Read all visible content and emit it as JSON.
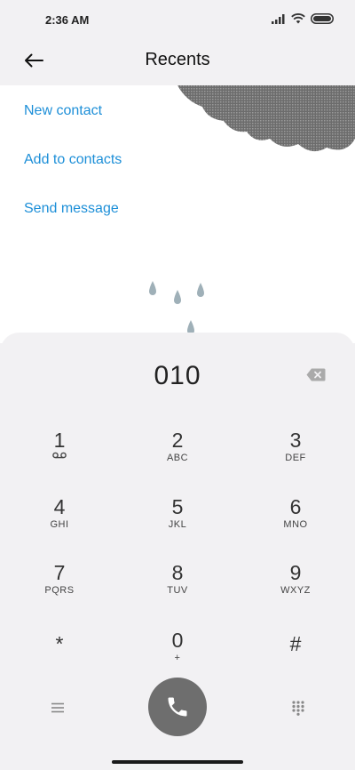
{
  "status_bar": {
    "time": "2:36 AM",
    "icons": [
      "signal-icon",
      "wifi-icon",
      "battery-icon"
    ]
  },
  "header": {
    "title": "Recents",
    "back_icon": "back-arrow-icon"
  },
  "actions": {
    "new_contact": "New contact",
    "add_to_contacts": "Add to contacts",
    "send_message": "Send message"
  },
  "dialer": {
    "number": "010",
    "keys": [
      {
        "digit": "1",
        "letters": ""
      },
      {
        "digit": "2",
        "letters": "ABC"
      },
      {
        "digit": "3",
        "letters": "DEF"
      },
      {
        "digit": "4",
        "letters": "GHI"
      },
      {
        "digit": "5",
        "letters": "JKL"
      },
      {
        "digit": "6",
        "letters": "MNO"
      },
      {
        "digit": "7",
        "letters": "PQRS"
      },
      {
        "digit": "8",
        "letters": "TUV"
      },
      {
        "digit": "9",
        "letters": "WXYZ"
      },
      {
        "digit": "*",
        "letters": ""
      },
      {
        "digit": "0",
        "letters": "+"
      },
      {
        "digit": "#",
        "letters": ""
      }
    ]
  },
  "colors": {
    "link": "#1d8fd8",
    "call_button": "#6e6e6e",
    "panel_bg": "#f2f1f3"
  }
}
